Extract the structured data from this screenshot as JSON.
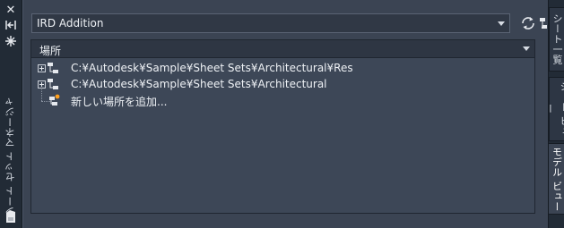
{
  "palette": {
    "title_rotated": "シート セット マネージャ"
  },
  "sheet_set": {
    "selected": "IRD Addition"
  },
  "section": {
    "label": "場所"
  },
  "tree": [
    {
      "label": "C:¥Autodesk¥Sample¥Sheet Sets¥Architectural¥Res",
      "expandable": true
    },
    {
      "label": "C:¥Autodesk¥Sample¥Sheet Sets¥Architectural",
      "expandable": true
    },
    {
      "label": "新しい場所を追加...",
      "expandable": false
    }
  ],
  "tabs": [
    {
      "label": "シート一覧",
      "active": false
    },
    {
      "label": "シート ビュー",
      "active": false
    },
    {
      "label": "モデル ビュー",
      "active": true
    }
  ],
  "icons": {
    "close": "close-icon",
    "autohide": "autohide-icon",
    "properties": "properties-icon",
    "refresh": "refresh-icon",
    "add_location": "add-location-icon",
    "location": "location-icon",
    "palette": "palette-icon"
  },
  "colors": {
    "accent": "#ff9f1c",
    "panel": "#3b4453"
  }
}
